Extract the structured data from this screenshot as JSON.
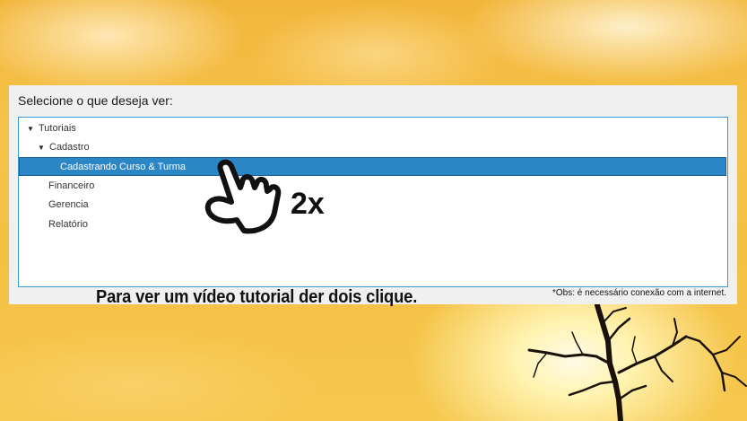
{
  "panel": {
    "title": "Selecione o que deseja ver:",
    "footer_note": "*Obs: é necessário conexão com a internet."
  },
  "tree": {
    "nodes": [
      {
        "label": "Tutoriais",
        "expanded": true
      },
      {
        "label": "Cadastro",
        "expanded": true
      },
      {
        "label": "Cadastrando Curso & Turma",
        "selected": true
      },
      {
        "label": "Financeiro"
      },
      {
        "label": "Gerencia"
      },
      {
        "label": "Relatório"
      }
    ]
  },
  "overlay": {
    "instruction": "Para ver um vídeo tutorial der dois clique.",
    "double_click_label": "2x",
    "hand_icon": "pointing-hand-icon"
  },
  "colors": {
    "selection": "#2b86c6",
    "tree_border": "#3c9ad8",
    "panel_bg": "#f0f0f0"
  }
}
